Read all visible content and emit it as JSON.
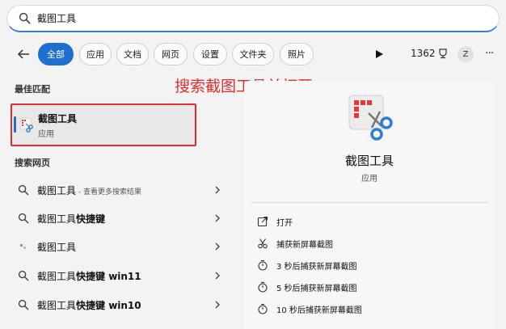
{
  "search": {
    "query": "截图工具"
  },
  "filters": [
    "全部",
    "应用",
    "文档",
    "网页",
    "设置",
    "文件夹",
    "照片"
  ],
  "toolbar": {
    "points": "1362",
    "avatar_letter": "Z",
    "more": "···"
  },
  "best_match": {
    "title": "最佳匹配",
    "name": "截图工具",
    "type": "应用"
  },
  "annotation": "搜索截图工具并打开",
  "web": {
    "title": "搜索网页",
    "items": [
      {
        "main": "截图工具",
        "sub": " - 查看更多搜索结果"
      },
      {
        "main": "截图工具",
        "bold": "快捷键"
      },
      {
        "main": "截图工具"
      },
      {
        "main": "截图工具",
        "bold": "快捷键 win11"
      },
      {
        "main": "截图工具",
        "bold": "快捷键 win10"
      }
    ]
  },
  "preview": {
    "name": "截图工具",
    "type": "应用",
    "actions": [
      "打开",
      "捕获新屏幕截图",
      "3 秒后捕获新屏幕截图",
      "5 秒后捕获新屏幕截图",
      "10 秒后捕获新屏幕截图"
    ]
  },
  "colors": {
    "accent": "#1f6fd1",
    "annotation": "#e0302e",
    "app_icon_red": "#e53935",
    "app_icon_blue": "#2d7fd3"
  }
}
